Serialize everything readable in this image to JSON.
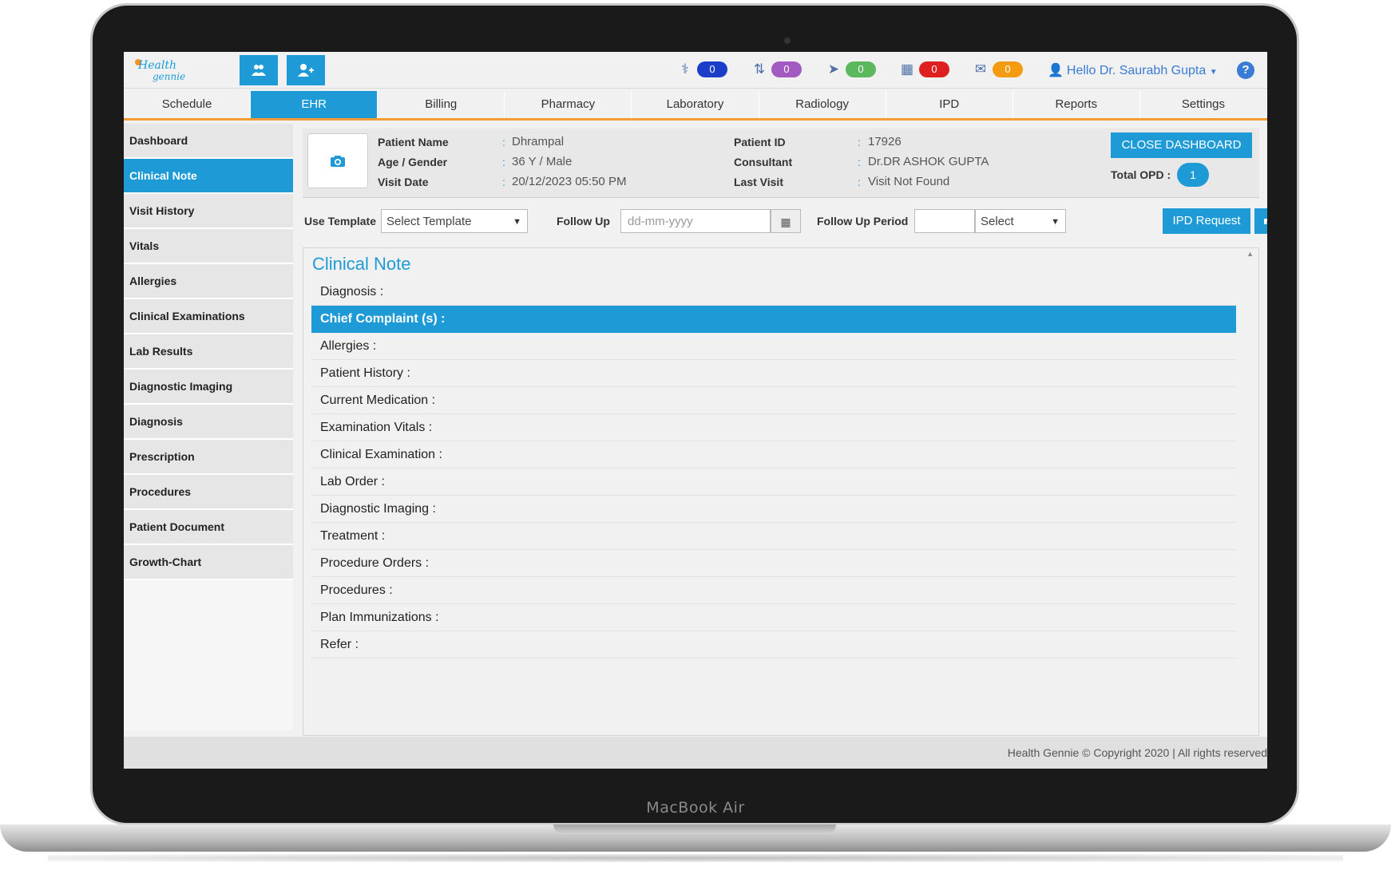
{
  "device_label": "MacBook Air",
  "header": {
    "logo_text_1": "Health",
    "logo_text_2": "gennie",
    "badges": [
      {
        "icon": "doctor-icon",
        "count": "0",
        "color": "#1a3ec8"
      },
      {
        "icon": "refresh-icon",
        "count": "0",
        "color": "#a35bc2"
      },
      {
        "icon": "send-icon",
        "count": "0",
        "color": "#5cb85c"
      },
      {
        "icon": "calendar-icon",
        "count": "0",
        "color": "#e02020"
      },
      {
        "icon": "mail-icon",
        "count": "0",
        "color": "#f39c12"
      }
    ],
    "user_greeting": "Hello Dr. Saurabh Gupta",
    "help_label": "?"
  },
  "tabs": [
    "Schedule",
    "EHR",
    "Billing",
    "Pharmacy",
    "Laboratory",
    "Radiology",
    "IPD",
    "Reports",
    "Settings"
  ],
  "active_tab": "EHR",
  "sidebar": {
    "items": [
      "Dashboard",
      "Clinical Note",
      "Visit History",
      "Vitals",
      "Allergies",
      "Clinical Examinations",
      "Lab Results",
      "Diagnostic Imaging",
      "Diagnosis",
      "Prescription",
      "Procedures",
      "Patient Document",
      "Growth-Chart"
    ],
    "active": "Clinical Note"
  },
  "patient": {
    "name_label": "Patient Name",
    "name": "Dhrampal",
    "age_label": "Age / Gender",
    "age": "36 Y / Male",
    "visit_label": "Visit Date",
    "visit": "20/12/2023 05:50 PM",
    "id_label": "Patient ID",
    "id": "17926",
    "consultant_label": "Consultant",
    "consultant": "Dr.DR ASHOK GUPTA",
    "last_visit_label": "Last Visit",
    "last_visit": "Visit Not Found",
    "colon": ":",
    "close_button": "CLOSE DASHBOARD",
    "total_opd_label": "Total OPD :",
    "total_opd": "1"
  },
  "form": {
    "template_label": "Use Template",
    "template_value": "Select Template",
    "followup_label": "Follow Up",
    "followup_placeholder": "dd-mm-yyyy",
    "period_label": "Follow Up Period",
    "period_select": "Select",
    "ipd_button": "IPD Request"
  },
  "clinical_note": {
    "title": "Clinical Note",
    "sections": [
      "Diagnosis :",
      "Chief Complaint (s) :",
      "Allergies :",
      "Patient History :",
      "Current Medication :",
      "Examination Vitals :",
      "Clinical Examination :",
      "Lab Order :",
      "Diagnostic Imaging :",
      "Treatment :",
      "Procedure Orders :",
      "Procedures :",
      "Plan Immunizations :",
      "Refer :"
    ],
    "active_section": "Chief Complaint (s) :"
  },
  "footer": "Health Gennie © Copyright 2020 | All rights reserved",
  "colors": {
    "accent": "#1e9bd7",
    "tab_underline": "#f39c32"
  }
}
